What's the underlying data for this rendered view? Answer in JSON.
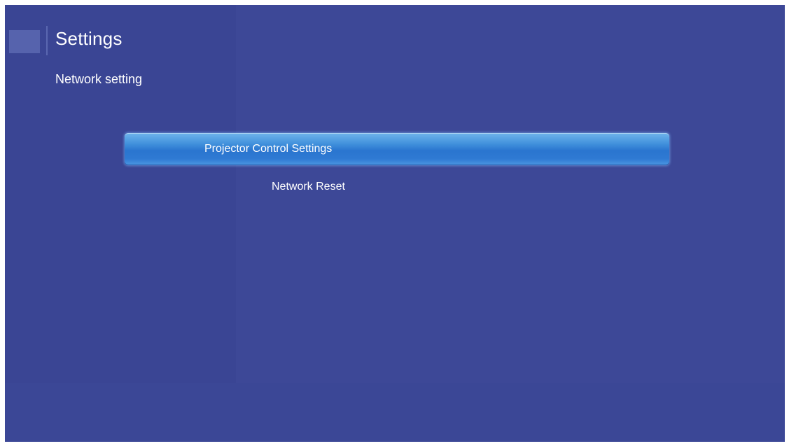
{
  "header": {
    "title": "Settings",
    "breadcrumb": "Network setting"
  },
  "menu": {
    "items": [
      {
        "label": "Projector Control Settings",
        "selected": true
      },
      {
        "label": "Network Reset",
        "selected": false
      }
    ]
  },
  "colors": {
    "background": "#3d4897",
    "selection": "#2a75cf",
    "text": "#ffffff"
  }
}
